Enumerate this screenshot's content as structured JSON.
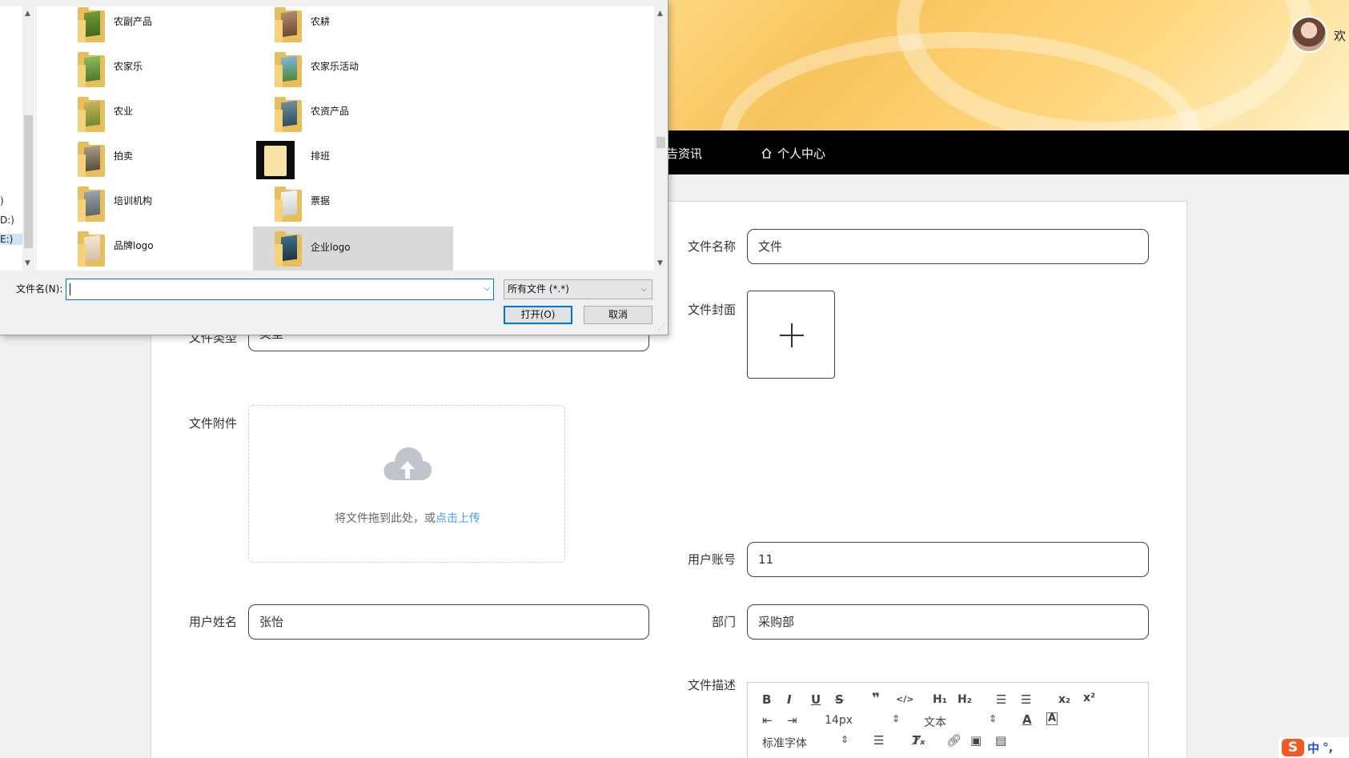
{
  "header": {
    "welcome": "欢",
    "nav": {
      "news": "告资讯",
      "profile": "个人中心"
    }
  },
  "form": {
    "file_name": {
      "label": "文件名称",
      "value": "文件"
    },
    "file_cover": {
      "label": "文件封面"
    },
    "file_type": {
      "label": "文件类型",
      "value": "类型"
    },
    "attachment": {
      "label": "文件附件",
      "hint": "将文件拖到此处，或",
      "link": "点击上传"
    },
    "account": {
      "label": "用户账号",
      "value": "11"
    },
    "username": {
      "label": "用户姓名",
      "value": "张怡"
    },
    "department": {
      "label": "部门",
      "value": "采购部"
    },
    "description": {
      "label": "文件描述"
    }
  },
  "editor": {
    "font_size": "14px",
    "text_style": "文本",
    "font_family": "标准字体",
    "buttons": [
      "B",
      "I",
      "U",
      "S",
      "99",
      "</>",
      "H1",
      "H2",
      "ol",
      "ul",
      "x₂",
      "x²",
      "outdent",
      "indent",
      "font-color",
      "background-color",
      "align",
      "clear-format",
      "link",
      "image",
      "video"
    ]
  },
  "ime": {
    "lang": "中",
    "punct": "°,"
  },
  "dialog": {
    "drives": [
      ")",
      "D:)",
      "E:)"
    ],
    "folders_col1": [
      "农副产品",
      "农家乐",
      "农业",
      "拍卖",
      "培训机构",
      "品牌logo"
    ],
    "folders_col2": [
      "农耕",
      "农家乐活动",
      "农资产品",
      "排班",
      "票据",
      "企业logo"
    ],
    "selected_folder": "企业logo",
    "filename_label": "文件名(N):",
    "filename_value": "",
    "filetype": "所有文件 (*.*)",
    "open_button": "打开(O)",
    "cancel_button": "取消"
  }
}
